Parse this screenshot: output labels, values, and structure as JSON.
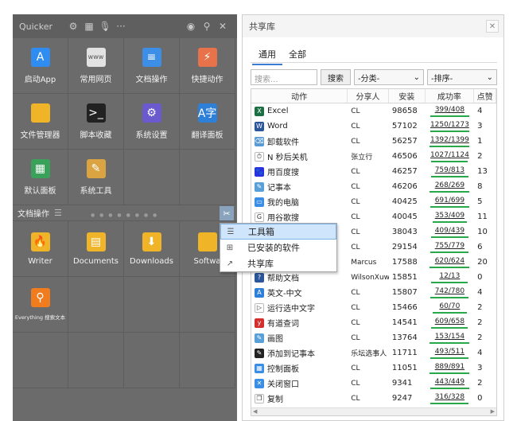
{
  "quicker": {
    "title": "Quicker",
    "top_grid": [
      {
        "label": "启动App",
        "icon": "app-store-icon",
        "color": "#2f8cf0",
        "glyph": "A"
      },
      {
        "label": "常用网页",
        "icon": "web-icon",
        "color": "#e2e2e2",
        "glyph": "www"
      },
      {
        "label": "文档操作",
        "icon": "document-icon",
        "color": "#3c8ee6",
        "glyph": "≡"
      },
      {
        "label": "快捷动作",
        "icon": "quick-actions-icon",
        "color": "#e8724a",
        "glyph": "⚡"
      },
      {
        "label": "文件管理器",
        "icon": "folder-icon",
        "color": "#f0b429",
        "glyph": ""
      },
      {
        "label": "脚本收藏",
        "icon": "terminal-icon",
        "color": "#222222",
        "glyph": ">_"
      },
      {
        "label": "系统设置",
        "icon": "settings-icon",
        "color": "#6a5acd",
        "glyph": "⚙"
      },
      {
        "label": "翻译面板",
        "icon": "translate-icon",
        "color": "#2d7fd8",
        "glyph": "A字"
      },
      {
        "label": "默认面板",
        "icon": "panel-grid-icon",
        "color": "#3aa15a",
        "glyph": "▦"
      },
      {
        "label": "系统工具",
        "icon": "tools-icon",
        "color": "#d9a441",
        "glyph": "✎"
      },
      {
        "label": "",
        "icon": "",
        "color": "",
        "glyph": ""
      },
      {
        "label": "",
        "icon": "",
        "color": "",
        "glyph": ""
      }
    ],
    "section_label": "文档操作",
    "bottom_grid": [
      {
        "label": "Writer",
        "icon": "writer-folder-icon",
        "color": "#f0b429",
        "glyph": "🔥"
      },
      {
        "label": "Documents",
        "icon": "documents-folder-icon",
        "color": "#f0b429",
        "glyph": "▤"
      },
      {
        "label": "Downloads",
        "icon": "downloads-folder-icon",
        "color": "#f0b429",
        "glyph": "⬇"
      },
      {
        "label": "Softwa",
        "icon": "software-folder-icon",
        "color": "#f0b429",
        "glyph": ""
      },
      {
        "label": "Everything 搜索文本",
        "icon": "everything-search-icon",
        "color": "#f07c1e",
        "glyph": "⚲"
      },
      {
        "label": "",
        "icon": "",
        "color": "",
        "glyph": ""
      },
      {
        "label": "",
        "icon": "",
        "color": "",
        "glyph": ""
      },
      {
        "label": "",
        "icon": "",
        "color": "",
        "glyph": ""
      },
      {
        "label": "",
        "icon": "",
        "color": "",
        "glyph": ""
      },
      {
        "label": "",
        "icon": "",
        "color": "",
        "glyph": ""
      },
      {
        "label": "",
        "icon": "",
        "color": "",
        "glyph": ""
      },
      {
        "label": "",
        "icon": "",
        "color": "",
        "glyph": ""
      }
    ]
  },
  "share": {
    "title": "共享库",
    "tabs": [
      "通用",
      "全部"
    ],
    "search_placeholder": "搜索...",
    "search_button": "搜索",
    "category_select": "-分类-",
    "sort_select": "-排序-",
    "columns": [
      "动作",
      "分享人",
      "安装",
      "成功率",
      "点赞"
    ],
    "rows": [
      {
        "name": "Excel",
        "sharer": "CL",
        "installs": "98658",
        "rate": "399/408",
        "rate_frac": 0.978,
        "likes": "4",
        "icon": "excel-icon",
        "color": "#1d7044",
        "glyph": "X"
      },
      {
        "name": "Word",
        "sharer": "CL",
        "installs": "57102",
        "rate": "1250/1273",
        "rate_frac": 0.982,
        "likes": "3",
        "icon": "word-icon",
        "color": "#2b579a",
        "glyph": "W"
      },
      {
        "name": "卸载软件",
        "sharer": "CL",
        "installs": "56257",
        "rate": "1392/1399",
        "rate_frac": 0.995,
        "likes": "1",
        "icon": "uninstall-icon",
        "color": "#5b9bd5",
        "glyph": "⌫"
      },
      {
        "name": "N 秒后关机",
        "sharer": "张立行",
        "installs": "46506",
        "rate": "1027/1124",
        "rate_frac": 0.914,
        "likes": "2",
        "icon": "clock-icon",
        "color": "#ffffff",
        "glyph": "⏱"
      },
      {
        "name": "用百度搜",
        "sharer": "CL",
        "installs": "46257",
        "rate": "759/813",
        "rate_frac": 0.934,
        "likes": "13",
        "icon": "baidu-icon",
        "color": "#2932e1",
        "glyph": "🐾"
      },
      {
        "name": "记事本",
        "sharer": "CL",
        "installs": "46206",
        "rate": "268/269",
        "rate_frac": 0.996,
        "likes": "8",
        "icon": "notepad-icon",
        "color": "#5aa0d8",
        "glyph": "✎"
      },
      {
        "name": "我的电脑",
        "sharer": "CL",
        "installs": "40425",
        "rate": "691/699",
        "rate_frac": 0.989,
        "likes": "5",
        "icon": "computer-icon",
        "color": "#3a8ee6",
        "glyph": "▭"
      },
      {
        "name": "用谷歌搜",
        "sharer": "CL",
        "installs": "40045",
        "rate": "353/409",
        "rate_frac": 0.863,
        "likes": "11",
        "icon": "google-icon",
        "color": "#ffffff",
        "glyph": "G"
      },
      {
        "name": "",
        "sharer": "CL",
        "installs": "38043",
        "rate": "409/439",
        "rate_frac": 0.932,
        "likes": "10",
        "icon": "",
        "color": "",
        "glyph": ""
      },
      {
        "name": "",
        "sharer": "CL",
        "installs": "29154",
        "rate": "755/779",
        "rate_frac": 0.969,
        "likes": "6",
        "icon": "",
        "color": "",
        "glyph": ""
      },
      {
        "name": "",
        "sharer": "Marcus",
        "installs": "17588",
        "rate": "620/624",
        "rate_frac": 0.994,
        "likes": "20",
        "icon": "",
        "color": "",
        "glyph": ""
      },
      {
        "name": "帮助文档",
        "sharer": "WilsonXuw",
        "installs": "15851",
        "rate": "12/13",
        "rate_frac": 0.923,
        "likes": "0",
        "icon": "help-doc-icon",
        "color": "#2b579a",
        "glyph": "?"
      },
      {
        "name": "英文-中文",
        "sharer": "CL",
        "installs": "15807",
        "rate": "742/780",
        "rate_frac": 0.951,
        "likes": "4",
        "icon": "translate-en-zh-icon",
        "color": "#2d7fd8",
        "glyph": "A"
      },
      {
        "name": "运行选中文字",
        "sharer": "CL",
        "installs": "15466",
        "rate": "60/70",
        "rate_frac": 0.857,
        "likes": "2",
        "icon": "run-icon",
        "color": "#ffffff",
        "glyph": "▷"
      },
      {
        "name": "有道查词",
        "sharer": "CL",
        "installs": "14541",
        "rate": "609/658",
        "rate_frac": 0.925,
        "likes": "2",
        "icon": "youdao-icon",
        "color": "#d32f2f",
        "glyph": "y"
      },
      {
        "name": "画图",
        "sharer": "CL",
        "installs": "13764",
        "rate": "153/154",
        "rate_frac": 0.994,
        "likes": "2",
        "icon": "paint-icon",
        "color": "#5aa0d8",
        "glyph": "✎"
      },
      {
        "name": "添加到记事本",
        "sharer": "乐坛选事人",
        "installs": "11711",
        "rate": "493/511",
        "rate_frac": 0.965,
        "likes": "4",
        "icon": "add-note-icon",
        "color": "#222222",
        "glyph": "✎"
      },
      {
        "name": "控制面板",
        "sharer": "CL",
        "installs": "11051",
        "rate": "889/891",
        "rate_frac": 0.998,
        "likes": "3",
        "icon": "control-panel-icon",
        "color": "#3a8ee6",
        "glyph": "▦"
      },
      {
        "name": "关闭窗口",
        "sharer": "CL",
        "installs": "9341",
        "rate": "443/449",
        "rate_frac": 0.987,
        "likes": "2",
        "icon": "close-window-icon",
        "color": "#3a8ee6",
        "glyph": "✕"
      },
      {
        "name": "复制",
        "sharer": "CL",
        "installs": "9247",
        "rate": "316/328",
        "rate_frac": 0.963,
        "likes": "0",
        "icon": "copy-icon",
        "color": "#ffffff",
        "glyph": "❐"
      }
    ]
  },
  "menu": {
    "items": [
      {
        "label": "工具箱",
        "icon": "list-icon",
        "glyph": "☰"
      },
      {
        "label": "已安装的软件",
        "icon": "windows-icon",
        "glyph": "⊞"
      },
      {
        "label": "共享库",
        "icon": "share-library-icon",
        "glyph": "↗"
      }
    ]
  },
  "colors": {
    "panel_bg": "#6b6b6b",
    "accent": "#3b7bd4",
    "success_bar": "#29a84a",
    "menu_highlight": "#cfe5fb"
  }
}
